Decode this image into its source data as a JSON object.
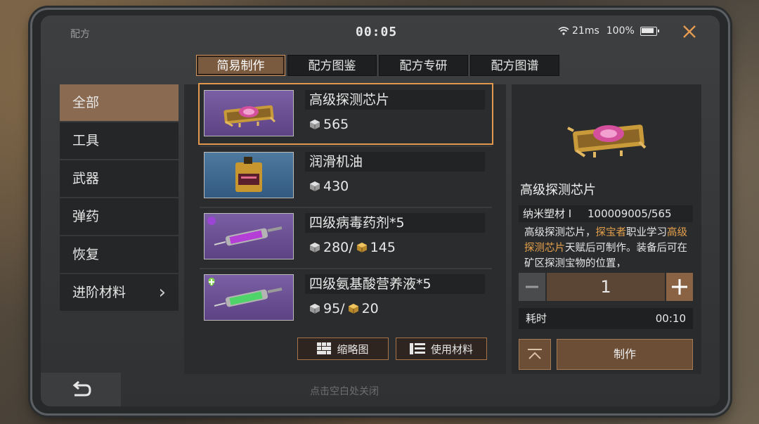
{
  "status": {
    "title": "配方",
    "time": "00:05",
    "ping": "21ms",
    "battery": "100%"
  },
  "tabs": [
    {
      "label": "简易制作",
      "active": true
    },
    {
      "label": "配方图鉴",
      "active": false
    },
    {
      "label": "配方专研",
      "active": false
    },
    {
      "label": "配方图谱",
      "active": false
    }
  ],
  "sidebar": [
    {
      "label": "全部",
      "active": true
    },
    {
      "label": "工具"
    },
    {
      "label": "武器"
    },
    {
      "label": "弹药"
    },
    {
      "label": "恢复"
    },
    {
      "label": "进阶材料",
      "has_chevron": true
    }
  ],
  "items": [
    {
      "name": "高级探测芯片",
      "cost_a": "565",
      "thumb": "chip",
      "selected": true
    },
    {
      "name": "润滑机油",
      "cost_a": "430",
      "thumb": "oil"
    },
    {
      "name": "四级病毒药剂*5",
      "cost_a": "280/",
      "cost_b": "145",
      "thumb": "syringe-virus"
    },
    {
      "name": "四级氨基酸营养液*5",
      "cost_a": "95/",
      "cost_b": "20",
      "thumb": "syringe-amino"
    }
  ],
  "buttons": {
    "thumbnail": "缩略图",
    "use_materials": "使用材料"
  },
  "detail": {
    "title": "高级探测芯片",
    "material_label": "纳米塑材 I",
    "material_count": "100009005/565",
    "desc_1": "高级探测芯片，",
    "desc_hl_1": "探宝者",
    "desc_2": "职业学习",
    "desc_hl_2": "高级探测芯片",
    "desc_3": "天赋后可制作。装备后可在矿区探测宝物的位置，",
    "quantity": "1",
    "time_label": "耗时",
    "time_value": "00:10",
    "make_label": "制作"
  },
  "hint": "点击空白处关闭",
  "colors": {
    "accent": "#e2974f",
    "highlight": "#e5a04b",
    "thumb_purple": "#6a4f94"
  }
}
